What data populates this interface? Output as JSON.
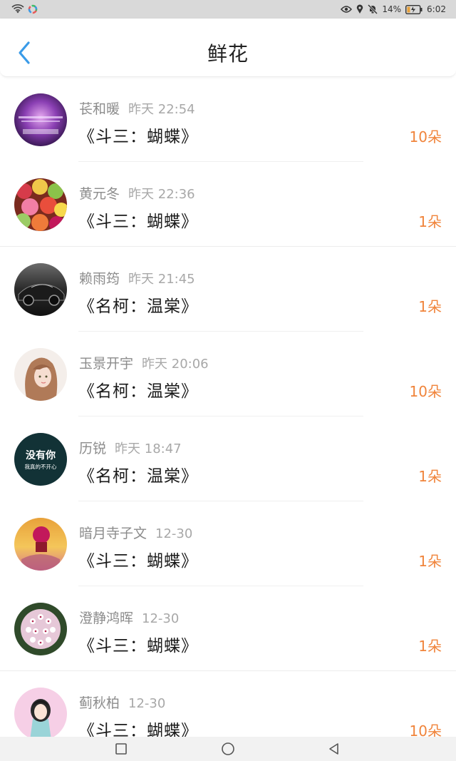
{
  "status_bar": {
    "battery_percent": "14%",
    "time": "6:02",
    "icons": [
      "wifi-icon",
      "app-notification-icon",
      "eye-icon",
      "location-icon",
      "mute-bell-icon",
      "battery-icon"
    ]
  },
  "header": {
    "title": "鲜花",
    "back_icon": "chevron-left-icon"
  },
  "list": {
    "items": [
      {
        "name": "苌和暖",
        "time": "昨天 22:54",
        "work": "《斗三：蝴蝶》",
        "count": "10朵",
        "avatar": "purple-text-avatar"
      },
      {
        "name": "黄元冬",
        "time": "昨天 22:36",
        "work": "《斗三：蝴蝶》",
        "count": "1朵",
        "avatar": "candy-avatar"
      },
      {
        "name": "赖雨筠",
        "time": "昨天 21:45",
        "work": "《名柯：温棠》",
        "count": "1朵",
        "avatar": "car-avatar"
      },
      {
        "name": "玉景开宇",
        "time": "昨天 20:06",
        "work": "《名柯：温棠》",
        "count": "10朵",
        "avatar": "girl-avatar"
      },
      {
        "name": "历锐",
        "time": "昨天 18:47",
        "work": "《名柯：温棠》",
        "count": "1朵",
        "avatar": "text-avatar",
        "avatar_text_main": "没有你",
        "avatar_text_sub": "我真的不开心"
      },
      {
        "name": "暗月寺子文",
        "time": "12-30",
        "work": "《斗三：蝴蝶》",
        "count": "1朵",
        "avatar": "sunset-avatar"
      },
      {
        "name": "澄静鸿晖",
        "time": "12-30",
        "work": "《斗三：蝴蝶》",
        "count": "1朵",
        "avatar": "flower-avatar"
      },
      {
        "name": "蓟秋柏",
        "time": "12-30",
        "work": "《斗三：蝴蝶》",
        "count": "10朵",
        "avatar": "cartoon-girl-avatar"
      }
    ]
  },
  "nav_bar": {
    "icons": [
      "recent-apps-icon",
      "home-icon",
      "back-icon"
    ]
  },
  "colors": {
    "accent_blue": "#3a9be8",
    "count_orange": "#f0843b",
    "status_bar_bg": "#d9d9d9"
  }
}
